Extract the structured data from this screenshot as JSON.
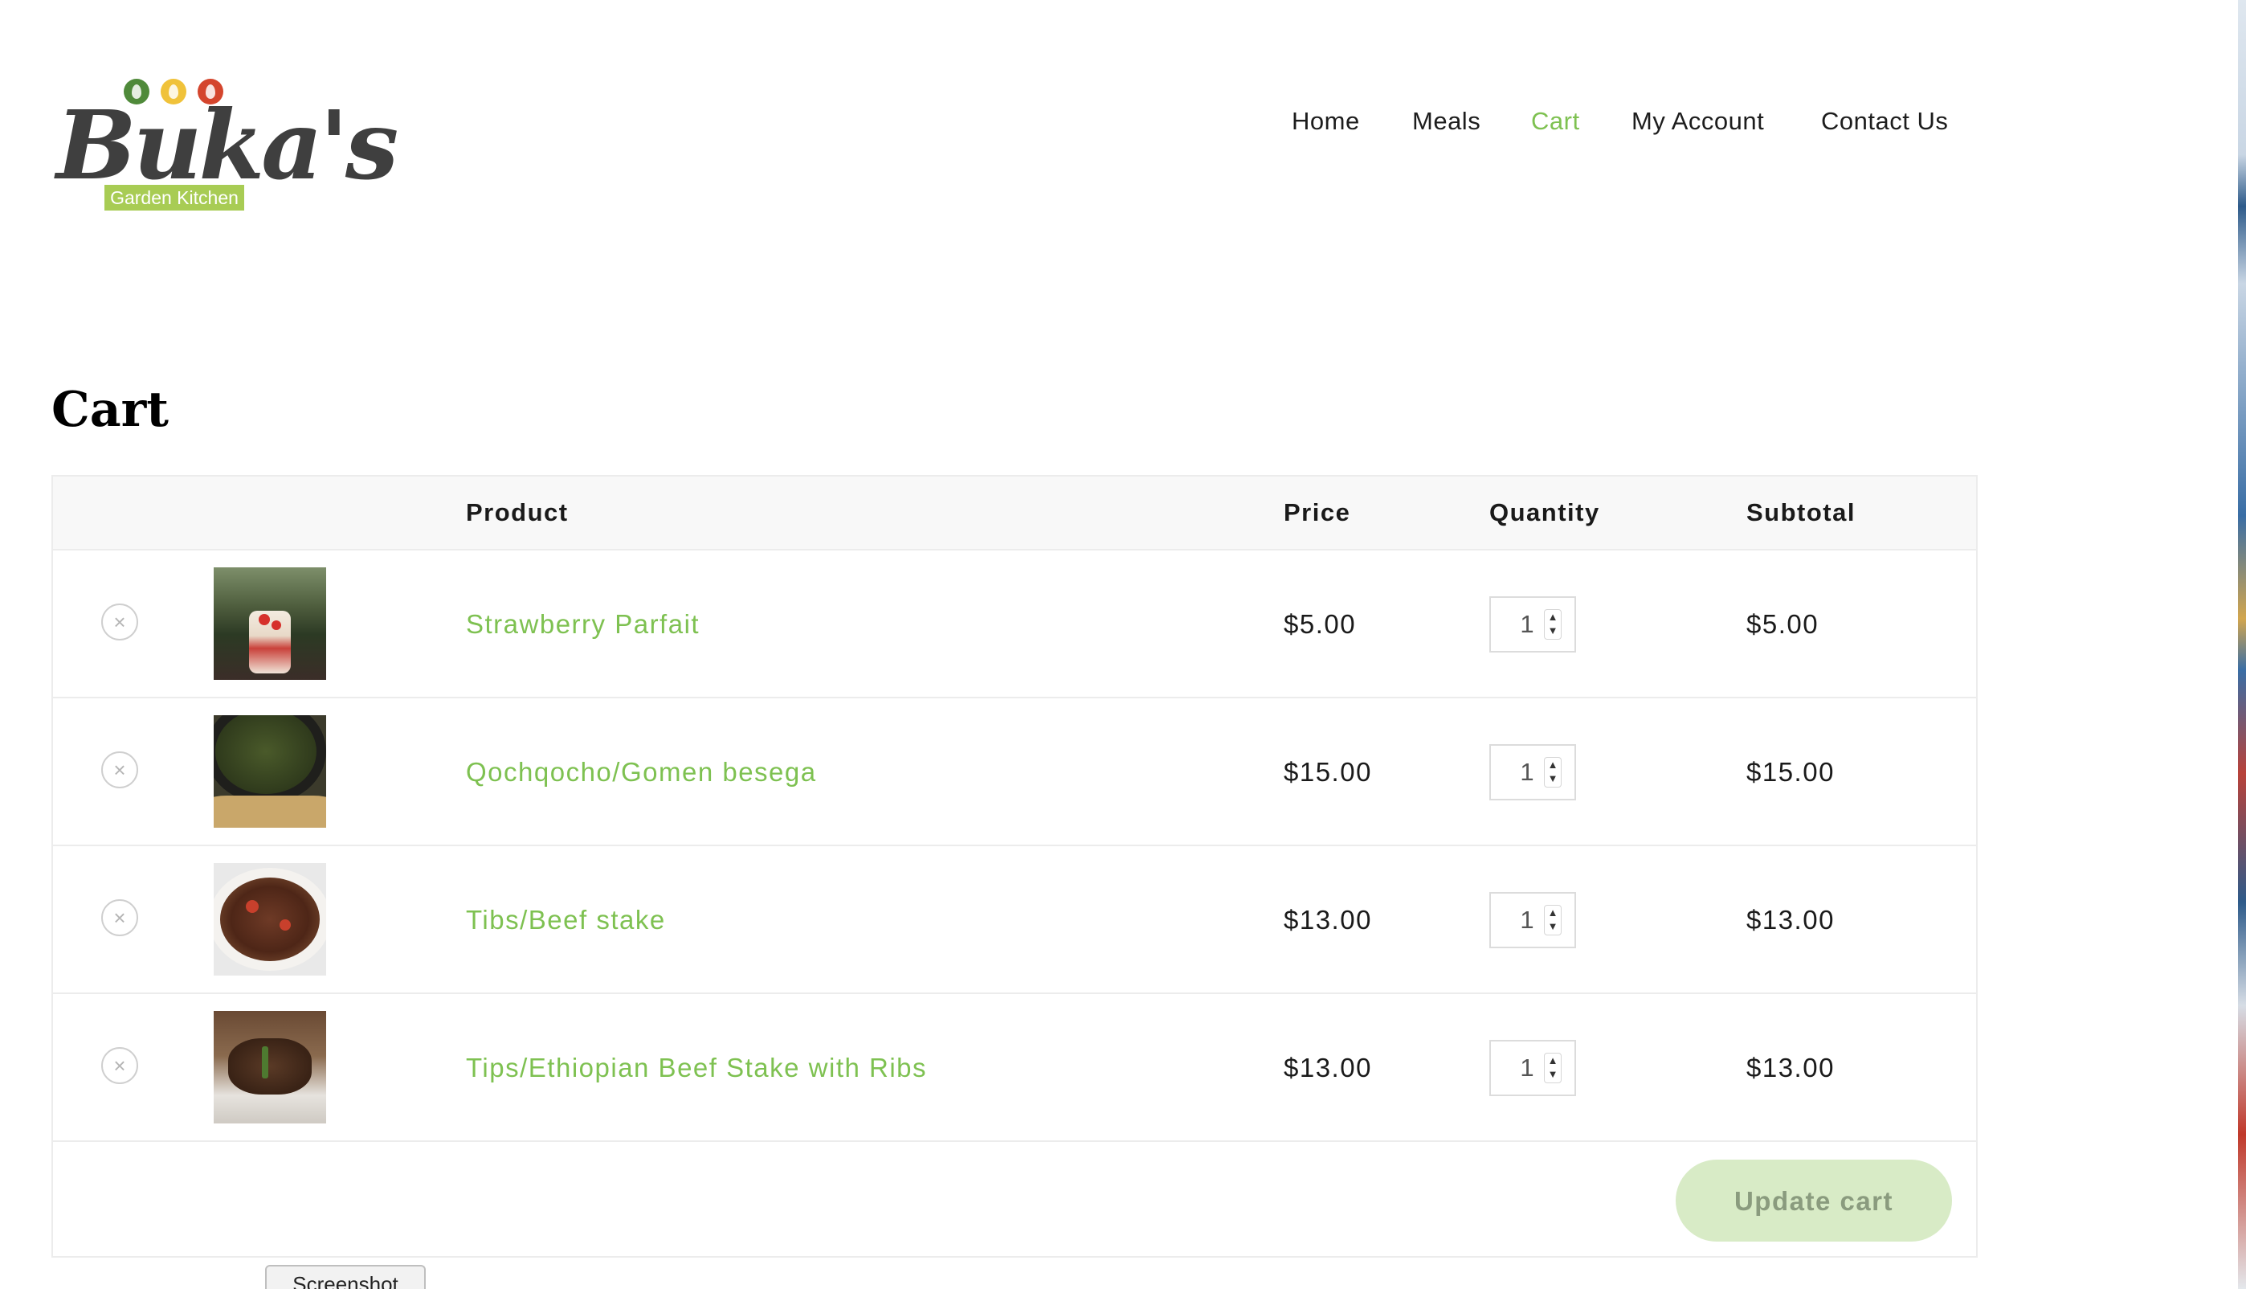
{
  "brand": {
    "name": "Buka's",
    "tagline": "Garden Kitchen"
  },
  "nav": {
    "items": [
      {
        "label": "Home",
        "active": false
      },
      {
        "label": "Meals",
        "active": false
      },
      {
        "label": "Cart",
        "active": true
      },
      {
        "label": "My Account",
        "active": false
      },
      {
        "label": "Contact Us",
        "active": false
      }
    ]
  },
  "page": {
    "title": "Cart"
  },
  "cart": {
    "headers": {
      "product": "Product",
      "price": "Price",
      "quantity": "Quantity",
      "subtotal": "Subtotal"
    },
    "items": [
      {
        "name": "Strawberry Parfait",
        "price": "$5.00",
        "quantity": "1",
        "subtotal": "$5.00",
        "remove_symbol": "×",
        "image_icon": "parfait-photo"
      },
      {
        "name": "Qochqocho/Gomen besega",
        "price": "$15.00",
        "quantity": "1",
        "subtotal": "$15.00",
        "remove_symbol": "×",
        "image_icon": "gomen-photo"
      },
      {
        "name": "Tibs/Beef stake",
        "price": "$13.00",
        "quantity": "1",
        "subtotal": "$13.00",
        "remove_symbol": "×",
        "image_icon": "tibs-photo"
      },
      {
        "name": "Tips/Ethiopian Beef Stake with Ribs",
        "price": "$13.00",
        "quantity": "1",
        "subtotal": "$13.00",
        "remove_symbol": "×",
        "image_icon": "ribs-photo"
      }
    ],
    "update_button": "Update cart"
  },
  "overlay": {
    "screenshot_tab": "Screenshot"
  },
  "colors": {
    "accent": "#7ec151",
    "update_button_bg": "#d8ebc6",
    "logo_green": "#a8cc54"
  }
}
